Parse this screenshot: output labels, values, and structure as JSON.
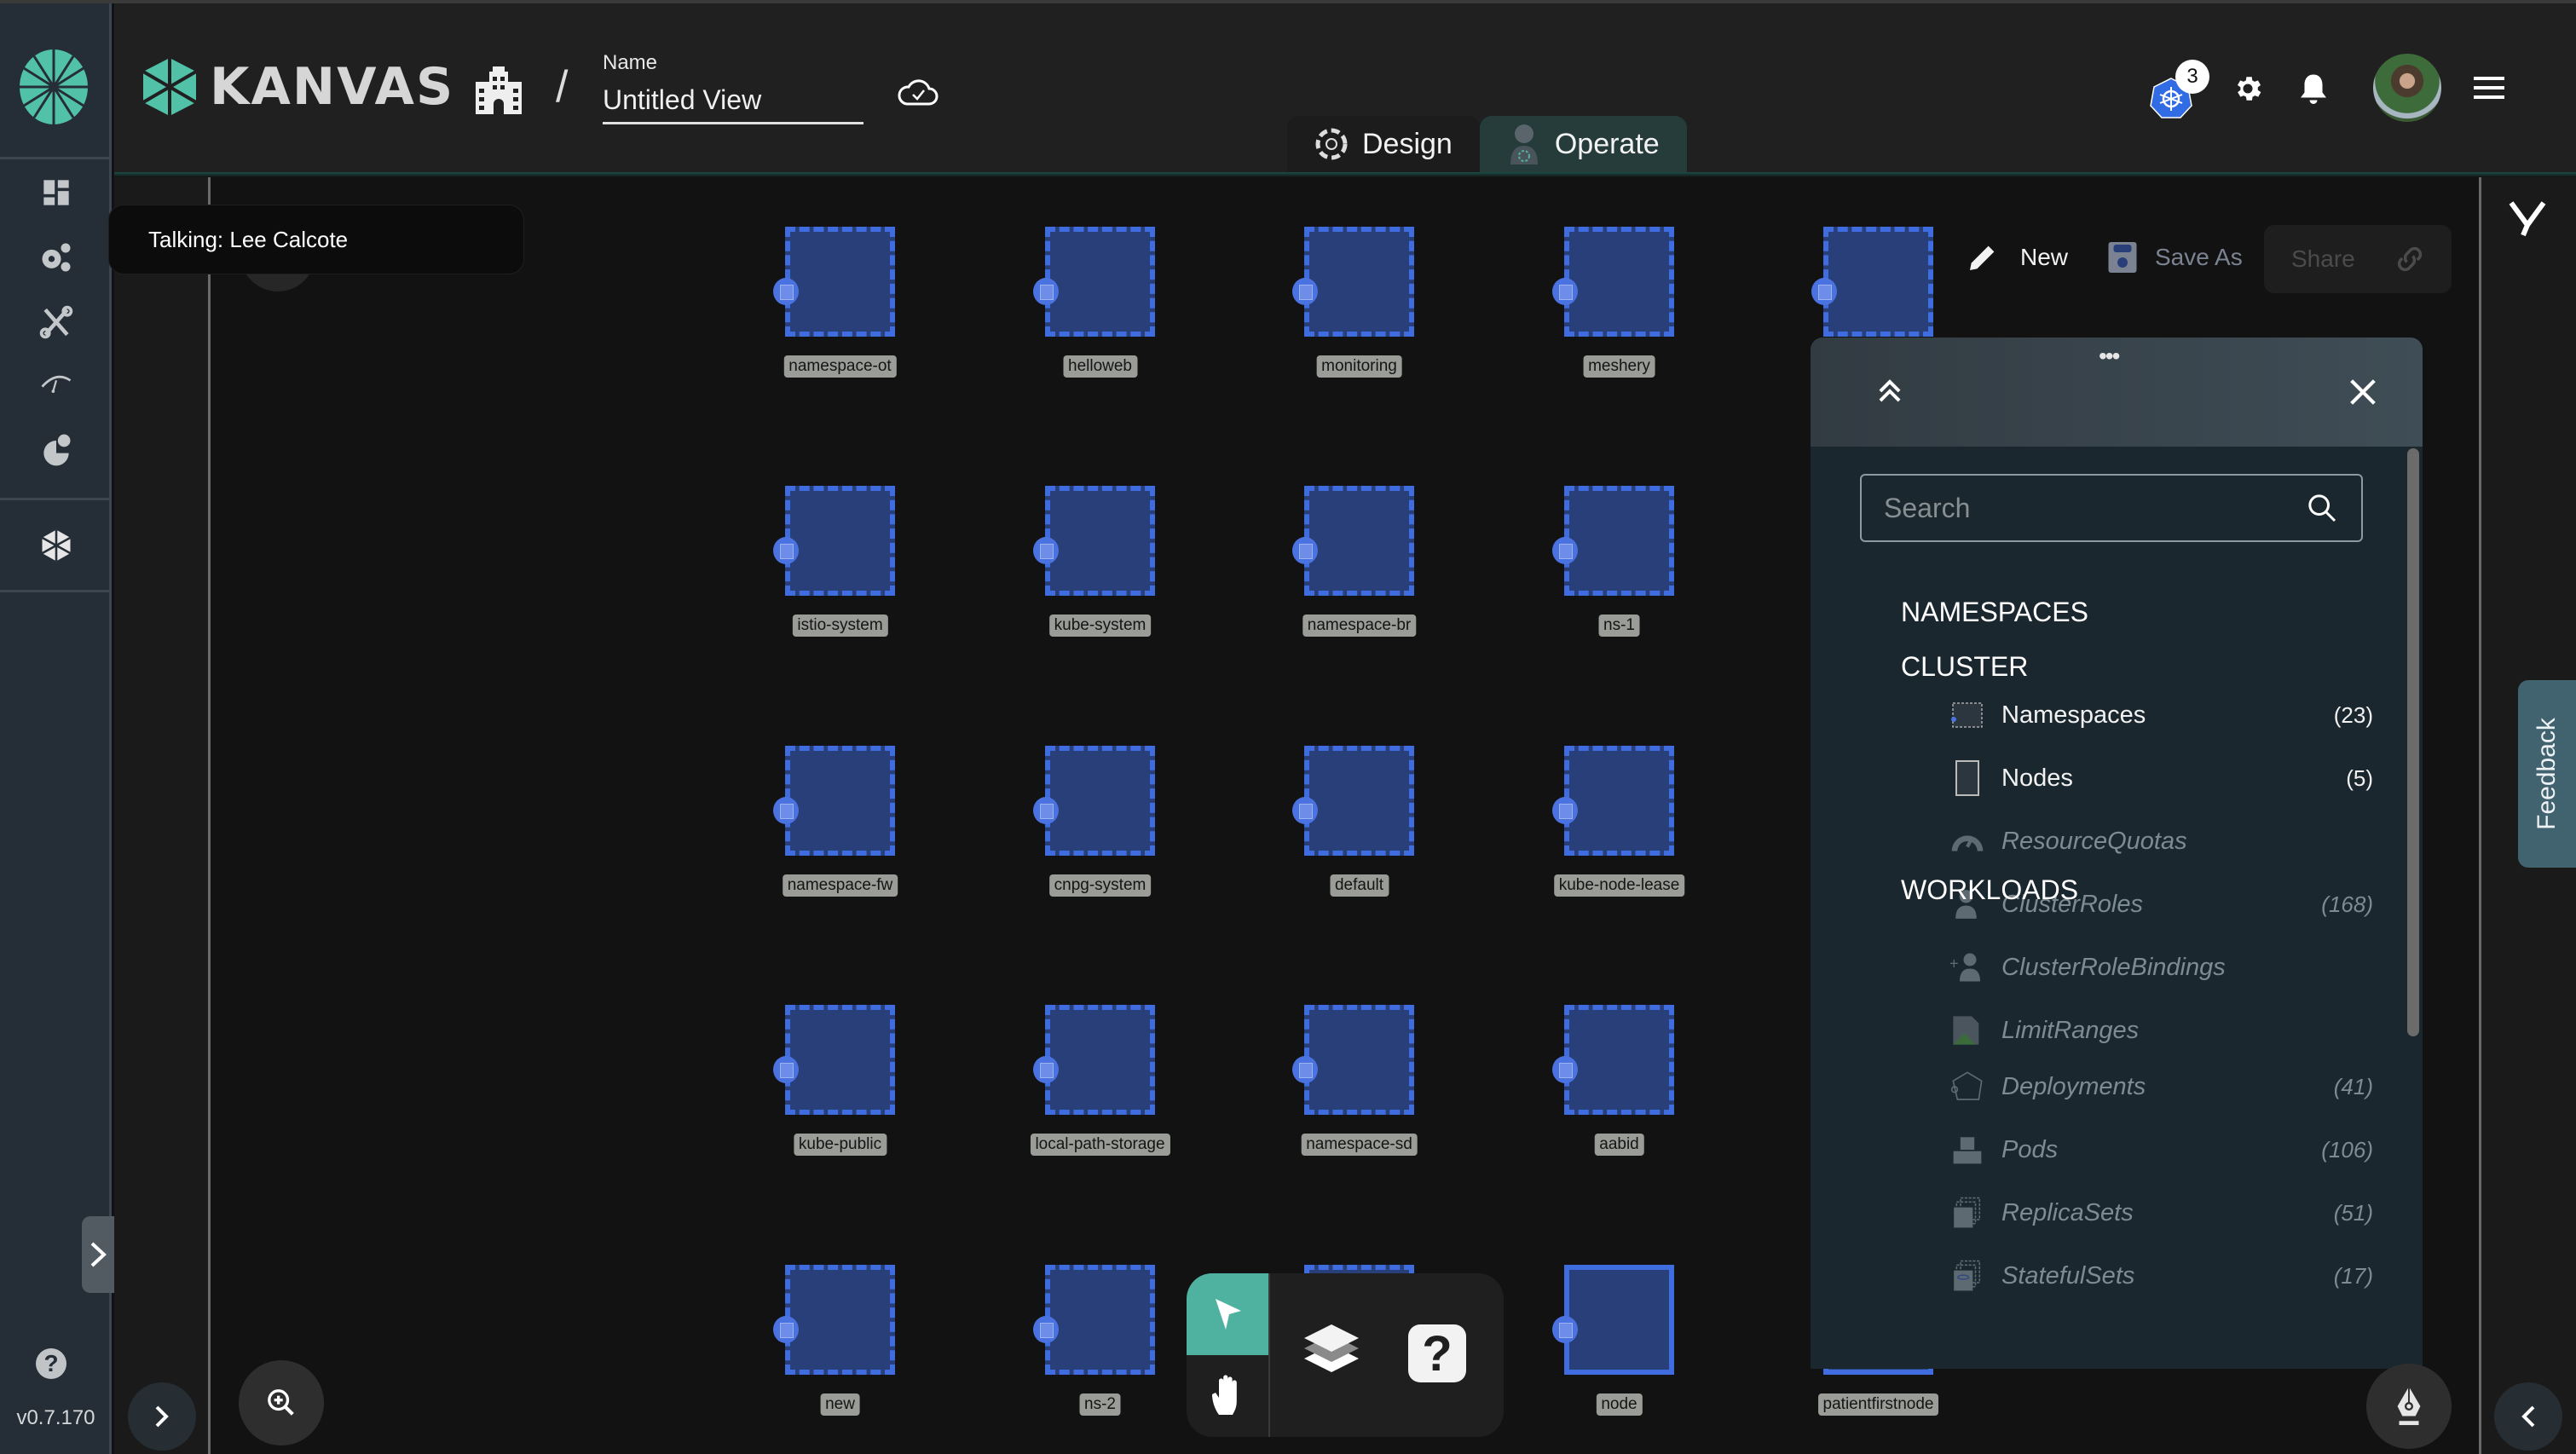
{
  "app": {
    "brand": "KANVAS",
    "version": "v0.7.170"
  },
  "header": {
    "name_label": "Name",
    "name_value": "Untitled View",
    "modes": [
      {
        "label": "Design",
        "icon": "design-icon",
        "active": false
      },
      {
        "label": "Operate",
        "icon": "operate-icon",
        "active": true
      }
    ],
    "k8s_badge_count": "3",
    "icons": [
      "kubernetes-icon",
      "gear-icon",
      "bell-icon",
      "avatar",
      "hamburger-menu-icon"
    ]
  },
  "sidebar": {
    "items": [
      {
        "name": "dashboard",
        "icon": "dashboard-icon"
      },
      {
        "name": "lifecycle",
        "icon": "gears-icon"
      },
      {
        "name": "configuration",
        "icon": "tools-icon"
      },
      {
        "name": "performance",
        "icon": "speedometer-icon"
      },
      {
        "name": "extensions",
        "icon": "meshmap-icon"
      },
      {
        "name": "kanvas",
        "icon": "kanvas-icon"
      }
    ]
  },
  "tooltip": {
    "text": "Talking: Lee Calcote"
  },
  "actions": {
    "new_label": "New",
    "save_as_label": "Save As",
    "share_label": "Share"
  },
  "canvas": {
    "nodes": [
      {
        "label": "namespace-ot",
        "row": 0,
        "col": 0
      },
      {
        "label": "helloweb",
        "row": 0,
        "col": 1
      },
      {
        "label": "monitoring",
        "row": 0,
        "col": 2
      },
      {
        "label": "meshery",
        "row": 0,
        "col": 3
      },
      {
        "label": "",
        "row": 0,
        "col": 4
      },
      {
        "label": "istio-system",
        "row": 1,
        "col": 0
      },
      {
        "label": "kube-system",
        "row": 1,
        "col": 1
      },
      {
        "label": "namespace-br",
        "row": 1,
        "col": 2
      },
      {
        "label": "ns-1",
        "row": 1,
        "col": 3
      },
      {
        "label": "namespace-fw",
        "row": 2,
        "col": 0
      },
      {
        "label": "cnpg-system",
        "row": 2,
        "col": 1
      },
      {
        "label": "default",
        "row": 2,
        "col": 2
      },
      {
        "label": "kube-node-lease",
        "row": 2,
        "col": 3
      },
      {
        "label": "kube-public",
        "row": 3,
        "col": 0
      },
      {
        "label": "local-path-storage",
        "row": 3,
        "col": 1
      },
      {
        "label": "namespace-sd",
        "row": 3,
        "col": 2
      },
      {
        "label": "aabid",
        "row": 3,
        "col": 3
      },
      {
        "label": "new",
        "row": 4,
        "col": 0
      },
      {
        "label": "ns-2",
        "row": 4,
        "col": 1
      },
      {
        "label": "",
        "row": 4,
        "col": 2
      },
      {
        "label": "node",
        "row": 4,
        "col": 3,
        "solid": true
      },
      {
        "label": "patientfirstnode",
        "row": 4,
        "col": 4,
        "solid": true
      }
    ]
  },
  "panel": {
    "search_placeholder": "Search",
    "sections": [
      {
        "title": "NAMESPACES",
        "items": []
      },
      {
        "title": "CLUSTER",
        "items": [
          {
            "label": "Namespaces",
            "count": "(23)",
            "enabled": true,
            "icon": "namespace-icon"
          },
          {
            "label": "Nodes",
            "count": "(5)",
            "enabled": true,
            "icon": "node-icon"
          },
          {
            "label": "ResourceQuotas",
            "count": "",
            "enabled": false,
            "icon": "resource-quota-icon"
          },
          {
            "label": "ClusterRoles",
            "count": "(168)",
            "enabled": false,
            "icon": "cluster-role-icon"
          },
          {
            "label": "ClusterRoleBindings",
            "count": "",
            "enabled": false,
            "icon": "cluster-role-binding-icon"
          },
          {
            "label": "LimitRanges",
            "count": "",
            "enabled": false,
            "icon": "limit-range-icon"
          }
        ]
      },
      {
        "title": "WORKLOADS",
        "items": [
          {
            "label": "Deployments",
            "count": "(41)",
            "enabled": false,
            "icon": "deployment-icon"
          },
          {
            "label": "Pods",
            "count": "(106)",
            "enabled": false,
            "icon": "pod-icon"
          },
          {
            "label": "ReplicaSets",
            "count": "(51)",
            "enabled": false,
            "icon": "replicaset-icon"
          },
          {
            "label": "StatefulSets",
            "count": "(17)",
            "enabled": false,
            "icon": "statefulset-icon"
          }
        ]
      }
    ]
  },
  "feedback_label": "Feedback",
  "colors": {
    "accent_teal": "#4fb2a0",
    "node_fill": "#283f7a",
    "node_border": "#3f6ddf",
    "k8s_blue": "#326ce5"
  }
}
